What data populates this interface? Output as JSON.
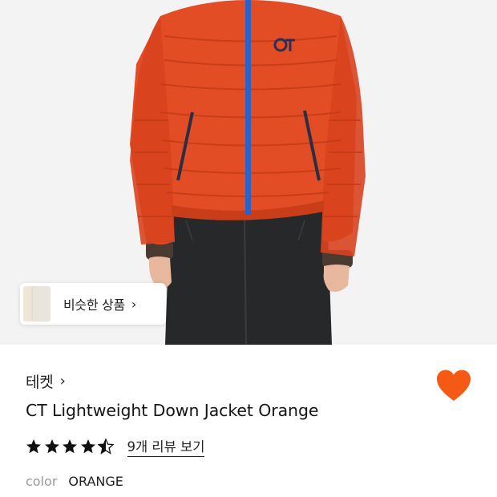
{
  "product_image": {
    "alt": "",
    "jacket_color": "#e24d26",
    "zipper_color": "#2a63c7"
  },
  "similar_products": {
    "label": "비슷한 상품",
    "chevron": "›"
  },
  "brand": {
    "name": "테켓",
    "chevron": "›"
  },
  "favorite": {
    "icon": "heart-icon",
    "active": true,
    "color": "#f45a14"
  },
  "product": {
    "title": "CT Lightweight Down Jacket Orange"
  },
  "rating": {
    "value": 4.5,
    "max": 5,
    "star_color": "#111111",
    "reviews_link": "9개 리뷰 보기"
  },
  "color_option": {
    "label": "color",
    "value": "ORANGE"
  }
}
